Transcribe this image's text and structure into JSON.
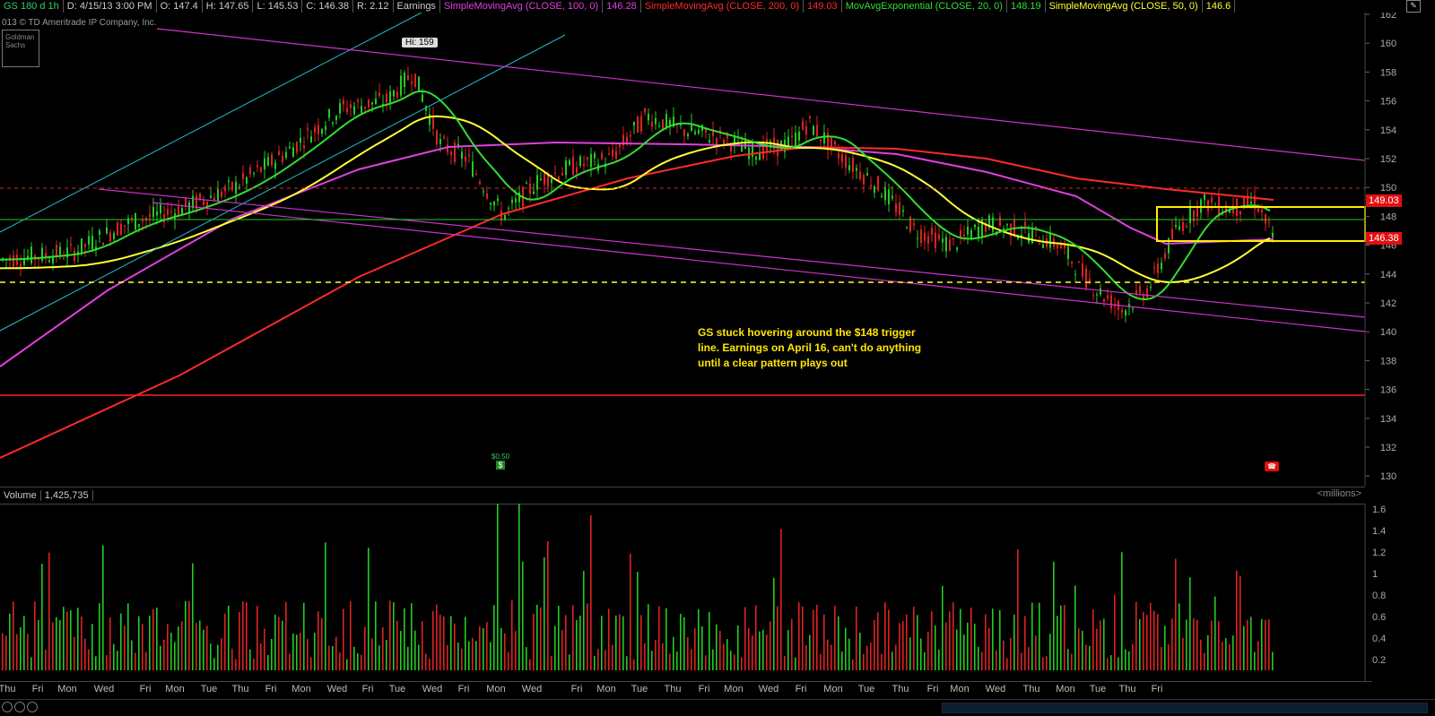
{
  "header": {
    "symbol": "GS 180 d 1h",
    "date": "D: 4/15/13 3:00 PM",
    "open": "O: 147.4",
    "high": "H: 147.65",
    "low": "L: 145.53",
    "close": "C: 146.38",
    "range": "R: 2.12",
    "earnings": "Earnings",
    "sma100_label": "SimpleMovingAvg (CLOSE, 100, 0)",
    "sma100_value": "146.28",
    "sma200_label": "SimpleMovingAvg (CLOSE, 200, 0)",
    "sma200_value": "149.03",
    "ema20_label": "MovAvgExponential (CLOSE, 20, 0)",
    "ema20_value": "148.19",
    "sma50_label": "SimpleMovingAvg (CLOSE, 50, 0)",
    "sma50_value": "146.6"
  },
  "copyright": "013 © TD Ameritrade IP Company, Inc.",
  "logo_text": "Goldman Sachs",
  "hi_label": "Hi: 159",
  "last_price_tag": "146.38",
  "sma200_tag": "149.03",
  "dividend_label": "$0.50",
  "dividend_icon": "$",
  "earnings_icon": "phone-icon",
  "annotation": "GS stuck hovering around the $148 trigger\nline. Earnings on April 16, can't do anything\nuntil a clear pattern plays out",
  "volume": {
    "label": "Volume",
    "value": "1,425,735",
    "units": "<millions>",
    "ticks": [
      "1.6",
      "1.4",
      "1.2",
      "1",
      "0.8",
      "0.6",
      "0.4",
      "0.2"
    ]
  },
  "price_axis_ticks": [
    "162",
    "160",
    "158",
    "156",
    "154",
    "152",
    "150",
    "148",
    "146",
    "144",
    "142",
    "140",
    "138",
    "136",
    "134",
    "132",
    "130"
  ],
  "x_axis_labels": [
    "Thu",
    "Fri",
    "Mon",
    "Wed",
    "Fri",
    "Mon",
    "Tue",
    "Thu",
    "Fri",
    "Mon",
    "Wed",
    "Fri",
    "Tue",
    "Wed",
    "Fri",
    "Mon",
    "Wed",
    "Fri",
    "Mon",
    "Tue",
    "Thu",
    "Fri",
    "Mon",
    "Wed",
    "Fri",
    "Mon",
    "Tue",
    "Thu",
    "Fri",
    "Mon",
    "Wed",
    "Thu",
    "Mon",
    "Tue",
    "Thu",
    "Fri"
  ],
  "colors": {
    "sma100": "#e040e0",
    "sma200": "#ff2a2a",
    "ema20": "#33dd33",
    "sma50": "#ffff33",
    "trendline_cyan": "#22bbcc",
    "up_volume": "#22cc22",
    "down_volume": "#dd2222"
  }
}
